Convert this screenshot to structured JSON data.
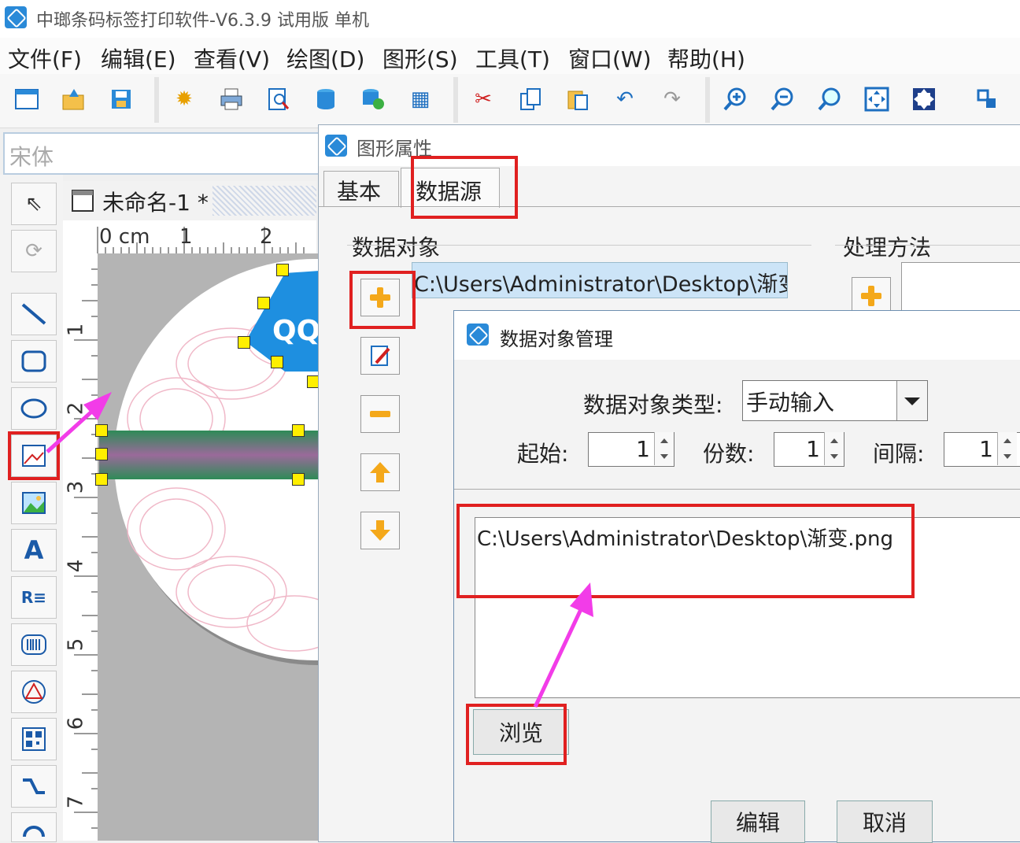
{
  "window": {
    "title": "中瑯条码标签打印软件-V6.3.9 试用版 单机"
  },
  "menu": [
    "文件(F)",
    "编辑(E)",
    "查看(V)",
    "绘图(D)",
    "图形(S)",
    "工具(T)",
    "窗口(W)",
    "帮助(H)"
  ],
  "font_box": {
    "value": "宋体"
  },
  "document": {
    "tab_label": "未命名-1 *"
  },
  "ruler": {
    "unit": "0 cm",
    "h_marks": [
      "1",
      "2"
    ],
    "v_marks": [
      "1",
      "2",
      "3",
      "4",
      "5",
      "6",
      "7"
    ]
  },
  "properties_dialog": {
    "title": "图形属性",
    "tabs": [
      "基本",
      "数据源"
    ],
    "data_object_label": "数据对象",
    "data_object_value": "C:\\Users\\Administrator\\Desktop\\渐变.p",
    "process_label": "处理方法"
  },
  "manager_dialog": {
    "title": "数据对象管理",
    "type_label": "数据对象类型:",
    "type_value": "手动输入",
    "start_label": "起始:",
    "start_value": "1",
    "copies_label": "份数:",
    "copies_value": "1",
    "interval_label": "间隔:",
    "interval_value": "1",
    "content": "C:\\Users\\Administrator\\Desktop\\渐变.png",
    "browse_label": "浏览",
    "edit_label": "编辑",
    "cancel_label": "取消"
  },
  "colors": {
    "highlight": "#e02020",
    "arrow": "#f23ce8",
    "accent": "#2a8ad8"
  }
}
